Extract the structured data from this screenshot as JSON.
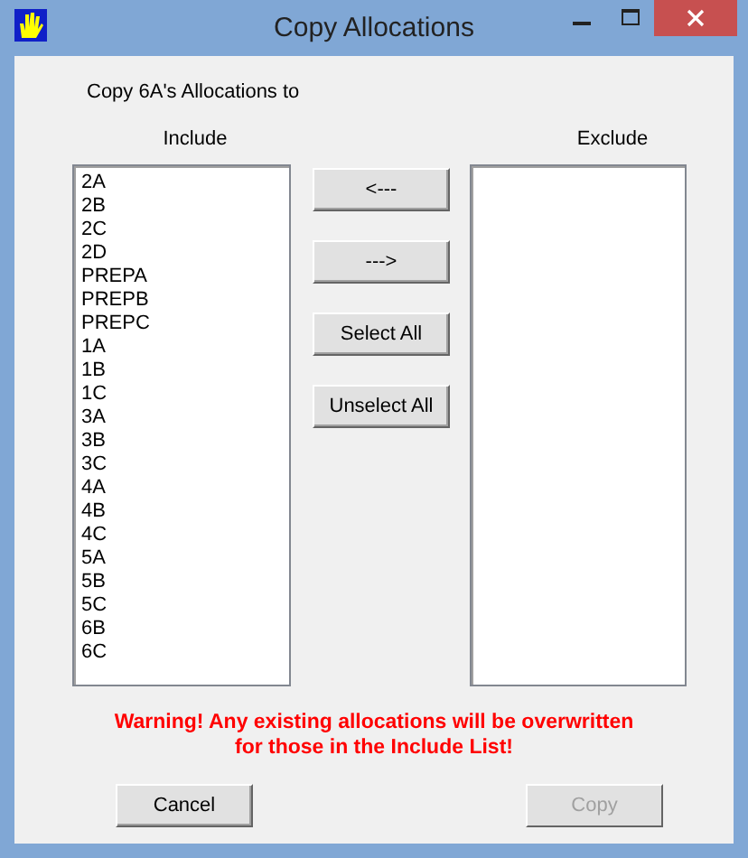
{
  "window": {
    "title": "Copy Allocations"
  },
  "heading": "Copy 6A's Allocations to",
  "include": {
    "label": "Include",
    "items": [
      "2A",
      "2B",
      "2C",
      "2D",
      "PREPA",
      "PREPB",
      "PREPC",
      "1A",
      "1B",
      "1C",
      "3A",
      "3B",
      "3C",
      "4A",
      "4B",
      "4C",
      "5A",
      "5B",
      "5C",
      "6B",
      "6C"
    ]
  },
  "move_buttons": [
    {
      "label": "<---",
      "disabled": false
    },
    {
      "label": "--->",
      "disabled": false
    },
    {
      "label": "Select All",
      "disabled": false
    },
    {
      "label": "Unselect All",
      "disabled": false
    }
  ],
  "exclude": {
    "label": "Exclude"
  },
  "warning": "Warning! Any existing allocations will be overwritten for those in the Include List!",
  "footer_buttons": [
    {
      "label": "Cancel",
      "disabled": false
    },
    {
      "label": "Copy",
      "disabled": true
    }
  ]
}
